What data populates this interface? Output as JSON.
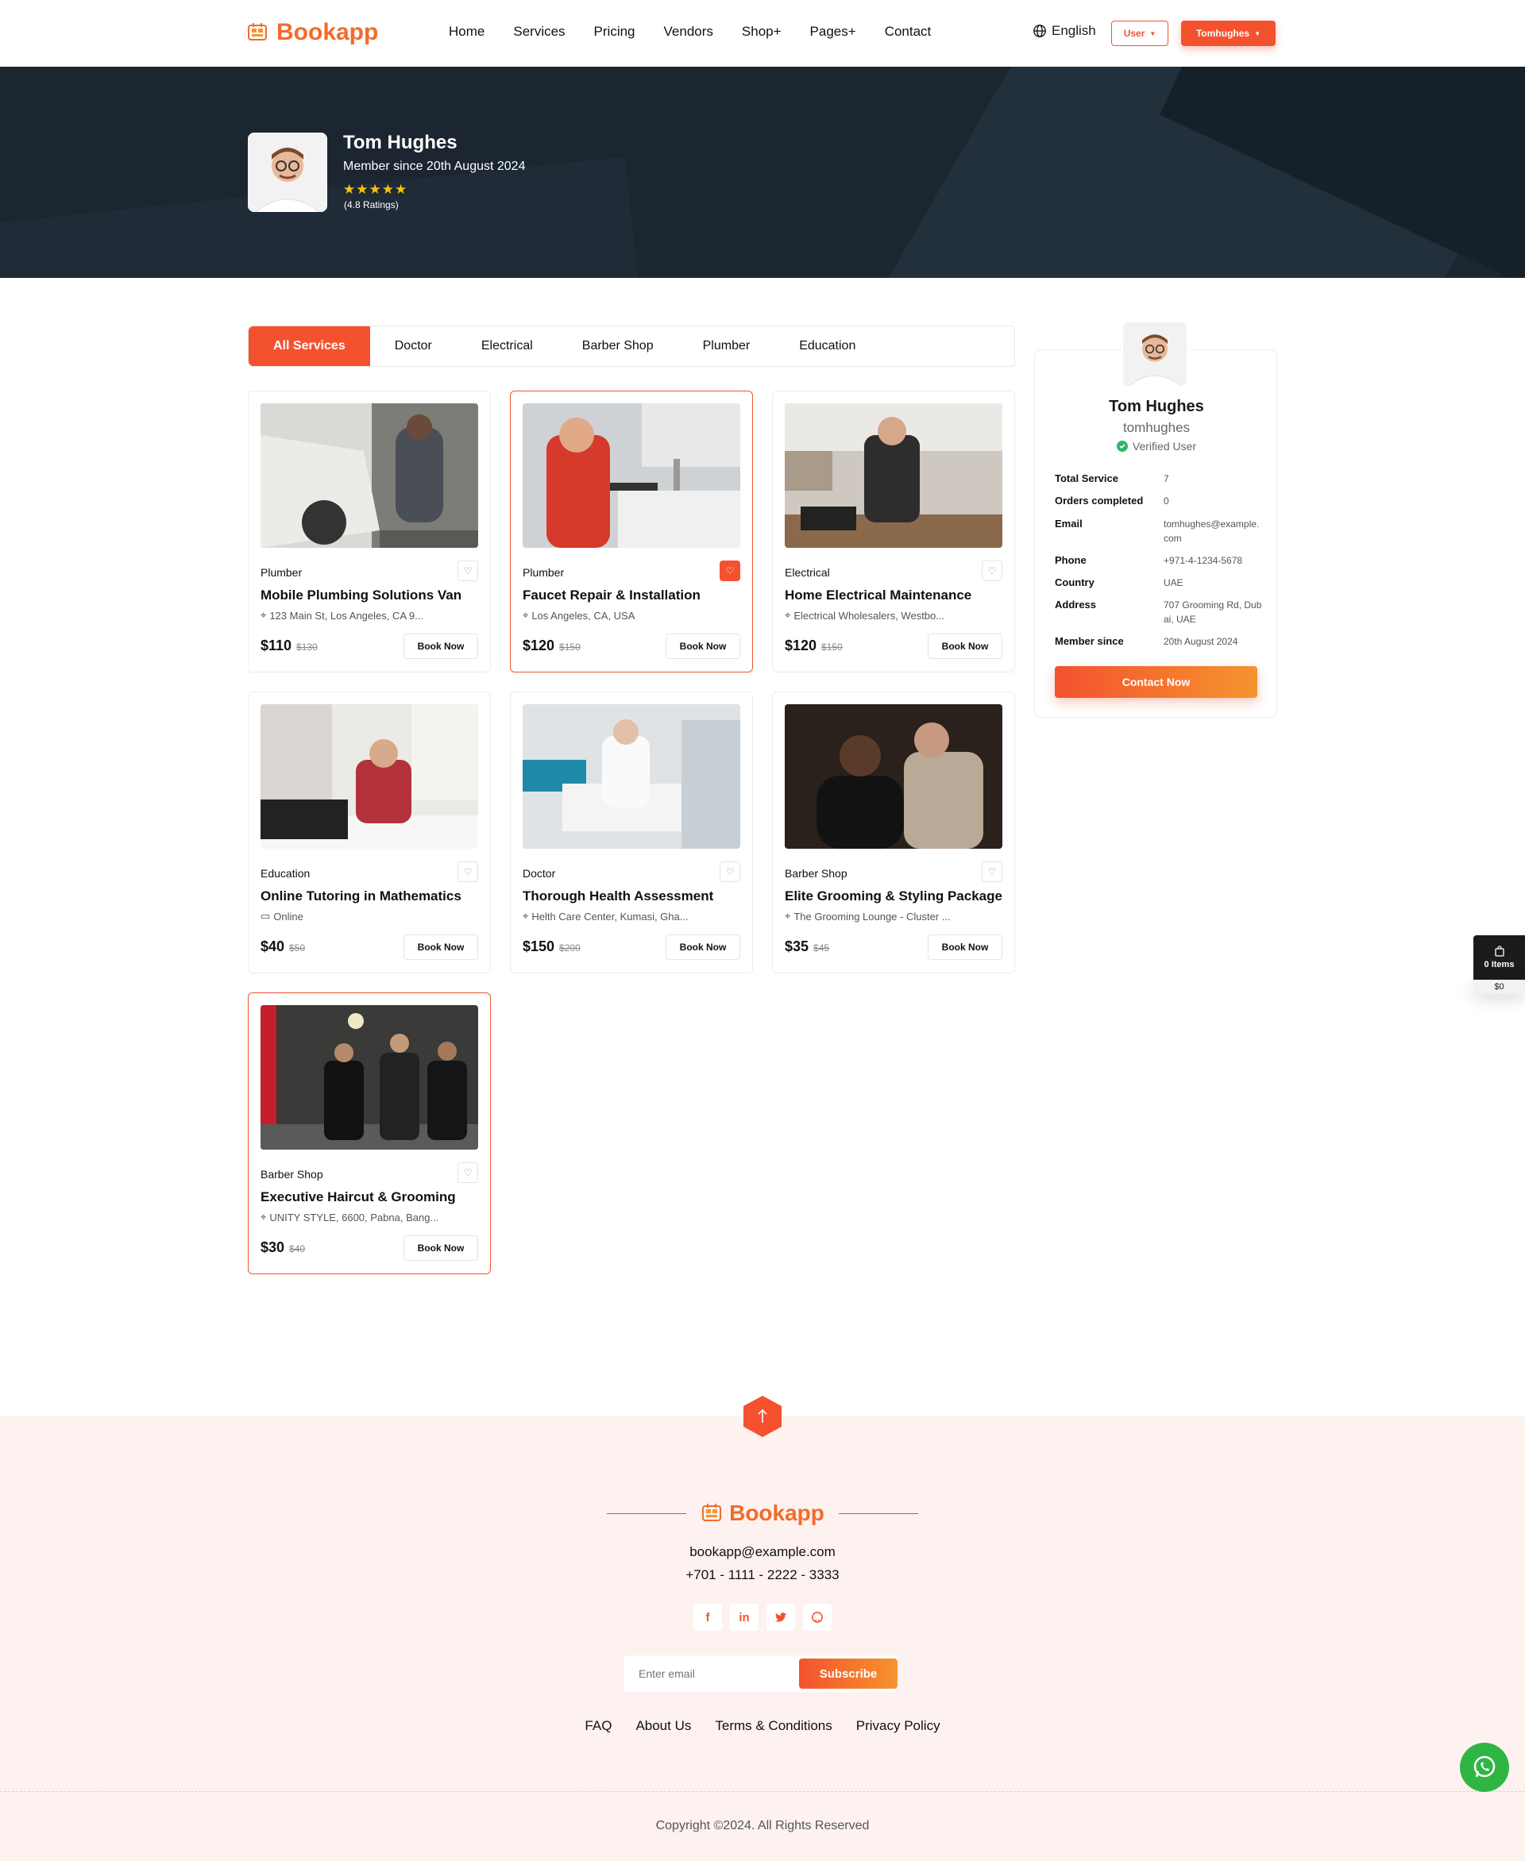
{
  "header": {
    "brand": "Bookapp",
    "nav": [
      "Home",
      "Services",
      "Pricing",
      "Vendors",
      "Shop+",
      "Pages+",
      "Contact"
    ],
    "language": "English",
    "user_button": "User",
    "account_button": "Tomhughes"
  },
  "hero": {
    "name": "Tom Hughes",
    "member_since": "Member since 20th August 2024",
    "stars": "★★★★★",
    "ratings": "(4.8 Ratings)"
  },
  "tabs": [
    "All Services",
    "Doctor",
    "Electrical",
    "Barber Shop",
    "Plumber",
    "Education"
  ],
  "services": [
    {
      "category": "Plumber",
      "title": "Mobile Plumbing Solutions Van",
      "location": "123 Main St, Los Angeles, CA 9...",
      "price": "$110",
      "old_price": "$130",
      "book": "Book Now",
      "loc_icon": "map-pin-icon"
    },
    {
      "category": "Plumber",
      "title": "Faucet Repair & Installation",
      "location": "Los Angeles, CA, USA",
      "price": "$120",
      "old_price": "$150",
      "book": "Book Now",
      "loc_icon": "map-pin-icon"
    },
    {
      "category": "Electrical",
      "title": "Home Electrical Maintenance",
      "location": "Electrical Wholesalers, Westbo...",
      "price": "$120",
      "old_price": "$150",
      "book": "Book Now",
      "loc_icon": "map-pin-icon"
    },
    {
      "category": "Education",
      "title": "Online Tutoring in Mathematics",
      "location": "Online",
      "price": "$40",
      "old_price": "$50",
      "book": "Book Now",
      "loc_icon": "video-icon"
    },
    {
      "category": "Doctor",
      "title": "Thorough Health Assessment",
      "location": "Helth Care Center, Kumasi, Gha...",
      "price": "$150",
      "old_price": "$200",
      "book": "Book Now",
      "loc_icon": "map-pin-icon"
    },
    {
      "category": "Barber Shop",
      "title": "Elite Grooming & Styling Package",
      "location": "The Grooming Lounge - Cluster ...",
      "price": "$35",
      "old_price": "$45",
      "book": "Book Now",
      "loc_icon": "map-pin-icon"
    },
    {
      "category": "Barber Shop",
      "title": "Executive Haircut & Grooming",
      "location": "UNITY STYLE, 6600, Pabna, Bang...",
      "price": "$30",
      "old_price": "$40",
      "book": "Book Now",
      "loc_icon": "map-pin-icon"
    }
  ],
  "profile": {
    "name": "Tom Hughes",
    "username": "tomhughes",
    "verified": "Verified User",
    "details": [
      {
        "label": "Total Service",
        "value": "7"
      },
      {
        "label": "Orders completed",
        "value": "0"
      },
      {
        "label": "Email",
        "value": "tomhughes@example.com"
      },
      {
        "label": "Phone",
        "value": "+971-4-1234-5678"
      },
      {
        "label": "Country",
        "value": "UAE"
      },
      {
        "label": "Address",
        "value": "707 Grooming Rd, Dubai, UAE"
      },
      {
        "label": "Member since",
        "value": "20th August 2024"
      }
    ],
    "contact_button": "Contact Now"
  },
  "cart": {
    "items": "0 Items",
    "total": "$0"
  },
  "footer": {
    "brand": "Bookapp",
    "email": "bookapp@example.com",
    "phone": "+701 - 1111 - 2222 - 3333",
    "socials": [
      "f",
      "in",
      "t",
      "gh"
    ],
    "subscribe_placeholder": "Enter email",
    "subscribe_button": "Subscribe",
    "links": [
      "FAQ",
      "About Us",
      "Terms & Conditions",
      "Privacy Policy"
    ],
    "copyright": "Copyright ©2024. All Rights Reserved"
  },
  "colors": {
    "accent": "#f4522f",
    "brand": "#f26b2a",
    "hero_bg": "#1b2631",
    "footer_bg": "#fdf2ef",
    "star": "#ffc107",
    "whatsapp": "#2fb544"
  }
}
